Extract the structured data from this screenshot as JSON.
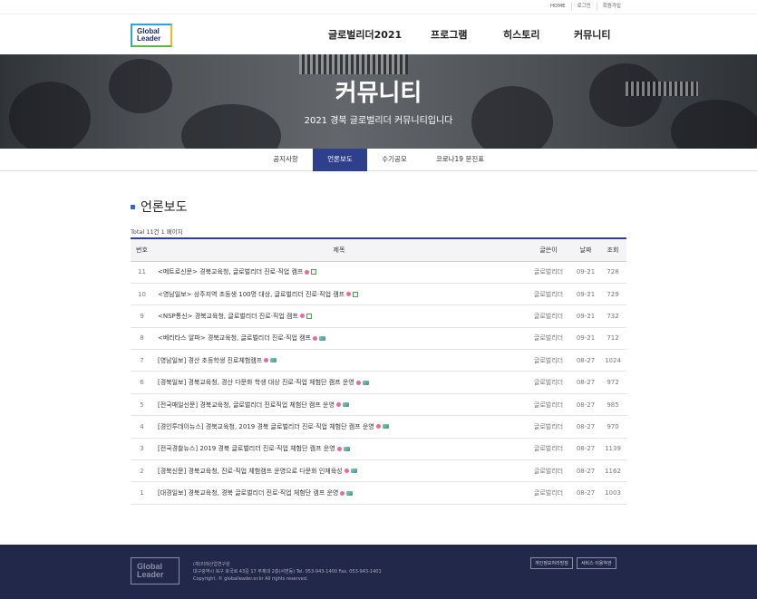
{
  "util": {
    "links": [
      "HOME",
      "로그인",
      "회원가입"
    ]
  },
  "logo": {
    "line1": "Global",
    "line2": "Leader"
  },
  "gnb": [
    "글로벌리더2021",
    "프로그램",
    "히스토리",
    "커뮤니티"
  ],
  "banner": {
    "title": "커뮤니티",
    "subtitle": "2021 경북 글로벌리더 커뮤니티입니다"
  },
  "subnav": {
    "tabs": [
      {
        "label": "공지사항",
        "active": false
      },
      {
        "label": "언론보도",
        "active": true
      },
      {
        "label": "수기공모",
        "active": false
      },
      {
        "label": "코로나19 문진표",
        "active": false
      }
    ]
  },
  "board": {
    "title": "언론보도",
    "total": "Total 11건 1 페이지",
    "columns": [
      "번호",
      "제목",
      "글쓴이",
      "날짜",
      "조회"
    ],
    "rows": [
      {
        "no": "11",
        "subject": "<메트로신문> 경북교육청, 글로벌리더 진로·직업 캠프",
        "author": "글로벌리더",
        "date": "09-21",
        "views": "728",
        "icons": [
          "heart-icon",
          "file-icon"
        ]
      },
      {
        "no": "10",
        "subject": "<영남일보> 상주지역 초등생 100명 대상, 글로벌리더 진로·직업 캠프",
        "author": "글로벌리더",
        "date": "09-21",
        "views": "729",
        "icons": [
          "heart-icon",
          "file-icon"
        ]
      },
      {
        "no": "9",
        "subject": "<NSP통신> 경북교육청, 글로벌리더 진로·직업 캠프",
        "author": "글로벌리더",
        "date": "09-21",
        "views": "732",
        "icons": [
          "heart-icon",
          "file-icon"
        ]
      },
      {
        "no": "8",
        "subject": "<베리타스 알파> 경북교육청, 글로벌리더 진로·직업 캠프",
        "author": "글로벌리더",
        "date": "09-21",
        "views": "712",
        "icons": [
          "heart-icon",
          "image-icon"
        ]
      },
      {
        "no": "7",
        "subject": "[영남일보] 경산 초등학생 진로체험캠프",
        "author": "글로벌리더",
        "date": "08-27",
        "views": "1024",
        "icons": [
          "heart-icon",
          "image-icon"
        ]
      },
      {
        "no": "6",
        "subject": "[경북일보] 경북교육청, 경산 다문화 학생 대상 진로·직업 체험단 캠프 운영",
        "author": "글로벌리더",
        "date": "08-27",
        "views": "972",
        "icons": [
          "heart-icon",
          "image-icon"
        ]
      },
      {
        "no": "5",
        "subject": "[전국매일신문] 경북교육청, 글로벌리더 진로직업 체험단 캠프 운영",
        "author": "글로벌리더",
        "date": "08-27",
        "views": "985",
        "icons": [
          "heart-icon",
          "image-icon"
        ]
      },
      {
        "no": "4",
        "subject": "[경인투데이뉴스] 경북교육청, 2019 경북 글로벌리더 진로·직업 체험단 캠프 운영",
        "author": "글로벌리더",
        "date": "08-27",
        "views": "970",
        "icons": [
          "heart-icon",
          "image-icon"
        ]
      },
      {
        "no": "3",
        "subject": "[전국경찰뉴스] 2019 경북 글로벌리더 진로·직업 체험단 캠프 운영",
        "author": "글로벌리더",
        "date": "08-27",
        "views": "1139",
        "icons": [
          "heart-icon",
          "image-icon"
        ]
      },
      {
        "no": "2",
        "subject": "[경북신문] 경북교육청, 진로·직업 체험캠프 운영으로 다문화 인재육성",
        "author": "글로벌리더",
        "date": "08-27",
        "views": "1162",
        "icons": [
          "heart-icon",
          "image-icon"
        ]
      },
      {
        "no": "1",
        "subject": "[대경일보] 경북교육청, 경북 글로벌리더 진로·직업 체험단 캠프 운영",
        "author": "글로벌리더",
        "date": "08-27",
        "views": "1003",
        "icons": [
          "heart-icon",
          "image-icon"
        ]
      }
    ]
  },
  "footer": {
    "logo_line1": "Global",
    "logo_line2": "Leader",
    "company": "(재)미래산업연구원",
    "address": "대구광역시 북구 호국로 43길 17 무제대 2층(서변동) Tel. 053-943-1400 Fax. 053-943-1401",
    "copyright": "Copyright. © globalleader.or.kr All rights reserved.",
    "buttons": [
      "개인정보처리방침",
      "서비스 이용약관"
    ]
  },
  "colors": {
    "accent": "#2e3f8c",
    "footer_bg": "#22284a",
    "title_square": "#2a6fd0"
  }
}
